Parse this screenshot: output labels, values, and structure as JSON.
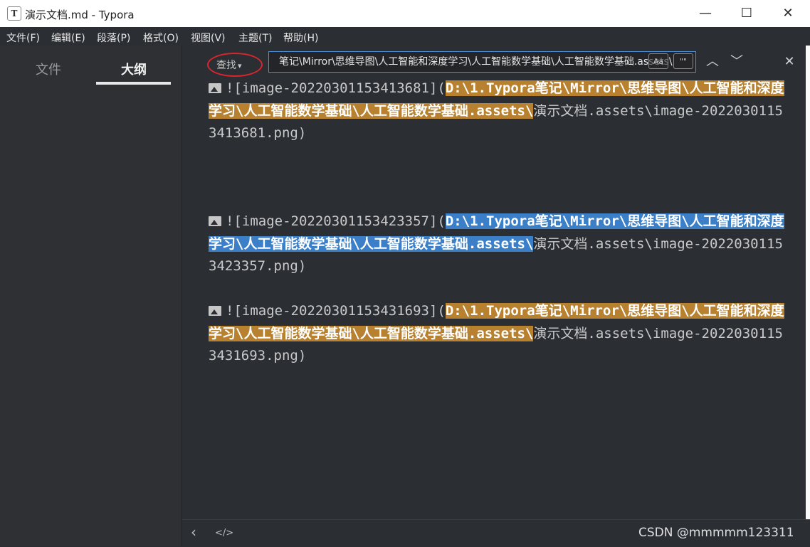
{
  "window": {
    "title": "演示文档.md - Typora",
    "logo_letter": "T",
    "minimize": "—",
    "maximize": "☐",
    "close": "✕"
  },
  "menu": [
    "文件(F)",
    "编辑(E)",
    "段落(P)",
    "格式(O)",
    "视图(V)",
    "主题(T)",
    "帮助(H)"
  ],
  "sidebar": {
    "tabs": [
      {
        "label": "文件",
        "active": false
      },
      {
        "label": "大纲",
        "active": true
      }
    ]
  },
  "find_bar": {
    "mode_label": "查找",
    "caret": "▾",
    "query": "笔记\\Mirror\\思维导图\\人工智能和深度学习\\人工智能数学基础\\人工智能数学基础.assets\\",
    "case_option": "Aa",
    "word_option": "\"\"",
    "prev_icon": "︿",
    "next_icon": "﹀",
    "close_icon": "✕"
  },
  "editor": {
    "paragraphs": [
      {
        "prefix": "![image-20220301153413681](",
        "match": "D:\\1.Typora笔记\\Mirror\\思维导图\\人工智能和深度学习\\人工智能数学基础\\人工智能数学基础.assets\\",
        "suffix": "演示文档.assets\\image-20220301153413681.png)",
        "highlight": "orange"
      },
      {
        "prefix": "![image-20220301153423357](",
        "match": "D:\\1.Typora笔记\\Mirror\\思维导图\\人工智能和深度学习\\人工智能数学基础\\人工智能数学基础.assets\\",
        "suffix": "演示文档.assets\\image-20220301153423357.png)",
        "highlight": "blue"
      },
      {
        "prefix": "![image-20220301153431693](",
        "match": "D:\\1.Typora笔记\\Mirror\\思维导图\\人工智能和深度学习\\人工智能数学基础\\人工智能数学基础.assets\\",
        "suffix": "演示文档.assets\\image-20220301153431693.png)",
        "highlight": "orange"
      }
    ]
  },
  "statusbar": {
    "back_icon": "‹",
    "source_icon": "</>"
  },
  "watermark": "CSDN @mmmmm123311",
  "colors": {
    "match_highlight": "#b8812f",
    "current_match": "#3a7fc7",
    "annotation_circle": "#d9262e"
  }
}
